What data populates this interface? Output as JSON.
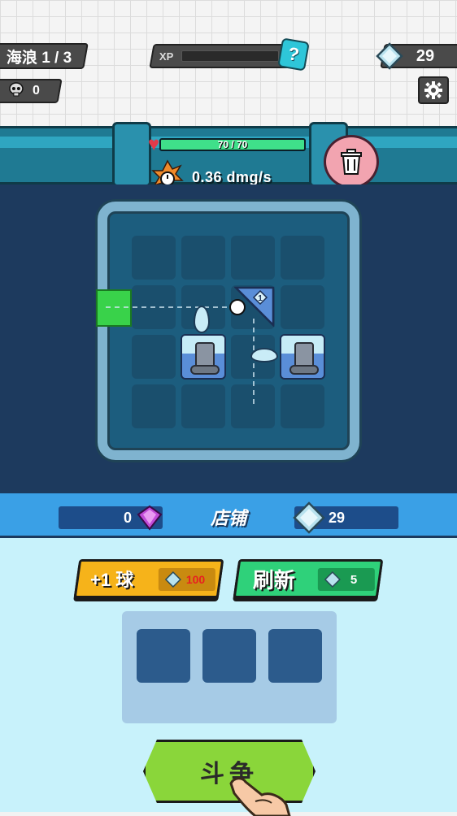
{
  "hud": {
    "wave_label": "海浪 1 / 3",
    "kills_count": "0",
    "xp_label": "XP",
    "xp_progress": 0.0,
    "xp_help": "?",
    "gems": "29"
  },
  "field": {
    "hp_text": "70 / 70",
    "hp_fraction": 1.0,
    "dps_text": "0.36 dmg/s",
    "deflector_level": "1"
  },
  "shop": {
    "title": "店铺",
    "purple_gems": "0",
    "gems": "29",
    "buy_ball_label": "+1 球",
    "buy_ball_cost": "100",
    "refresh_label": "刷新",
    "refresh_cost": "5",
    "fight_label": "斗争"
  },
  "colors": {
    "gem_blue": "#a8d8e8",
    "gem_purple": "#c04ad8",
    "cost_red": "#e82020",
    "goal_green": "#39d24a"
  }
}
